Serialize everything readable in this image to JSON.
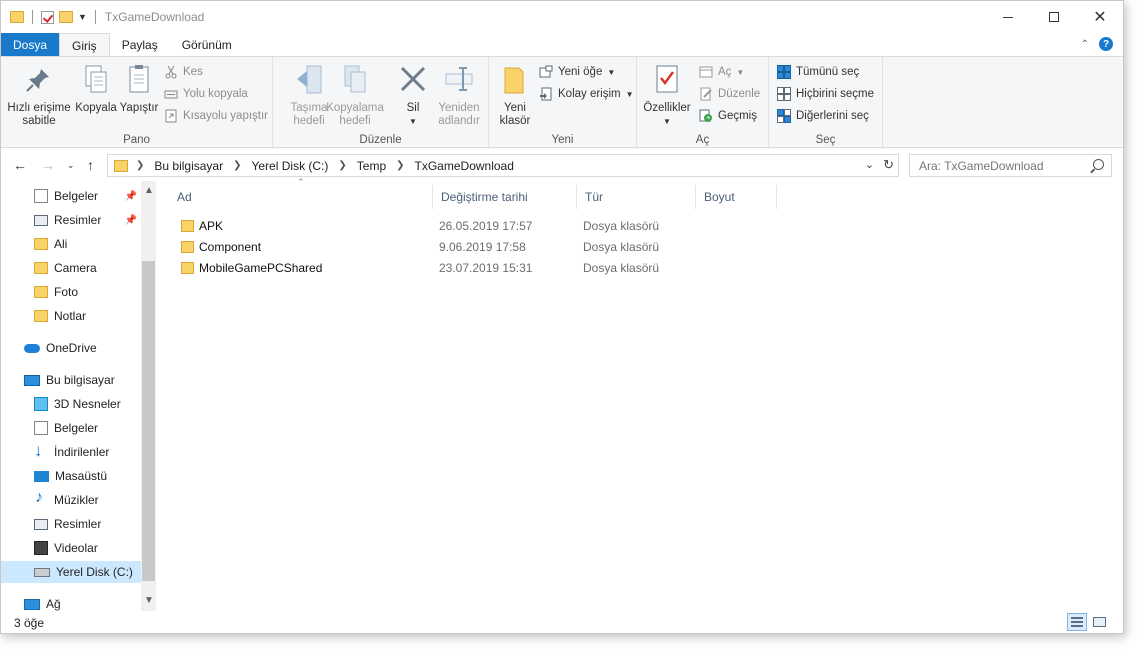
{
  "window": {
    "title": "TxGameDownload"
  },
  "tabs": {
    "file": "Dosya",
    "home": "Giriş",
    "share": "Paylaş",
    "view": "Görünüm",
    "help": "?"
  },
  "ribbon": {
    "pano": {
      "label": "Pano",
      "pin": [
        "Hızlı erişime",
        "sabitle"
      ],
      "copy": "Kopyala",
      "paste": "Yapıştır",
      "cut": "Kes",
      "copy_path": "Yolu kopyala",
      "paste_shortcut": "Kısayolu yapıştır"
    },
    "duzenle": {
      "label": "Düzenle",
      "move": [
        "Taşıma",
        "hedefi"
      ],
      "copyto": [
        "Kopyalama",
        "hedefi"
      ],
      "delete": "Sil",
      "rename": [
        "Yeniden",
        "adlandır"
      ]
    },
    "yeni": {
      "label": "Yeni",
      "new_folder": [
        "Yeni",
        "klasör"
      ],
      "new_item": "Yeni öğe",
      "easy_access": "Kolay erişim"
    },
    "ac": {
      "label": "Aç",
      "properties": "Özellikler",
      "open": "Aç",
      "edit": "Düzenle",
      "history": "Geçmiş"
    },
    "sec": {
      "label": "Seç",
      "select_all": "Tümünü seç",
      "select_none": "Hiçbirini seçme",
      "invert": "Diğerlerini seç"
    }
  },
  "address": {
    "crumbs": [
      "Bu bilgisayar",
      "Yerel Disk (C:)",
      "Temp",
      "TxGameDownload"
    ],
    "search_placeholder": "Ara: TxGameDownload"
  },
  "nav": {
    "items": [
      {
        "label": "Belgeler",
        "icon": "documents-icon",
        "pinned": true
      },
      {
        "label": "Resimler",
        "icon": "pictures-icon",
        "pinned": true
      },
      {
        "label": "Ali",
        "icon": "folder-icon"
      },
      {
        "label": "Camera",
        "icon": "folder-icon"
      },
      {
        "label": "Foto",
        "icon": "folder-icon"
      },
      {
        "label": "Notlar",
        "icon": "folder-icon"
      },
      {
        "label": "OneDrive",
        "icon": "onedrive-icon"
      },
      {
        "label": "Bu bilgisayar",
        "icon": "this-pc-icon"
      },
      {
        "label": "3D Nesneler",
        "icon": "3d-objects-icon"
      },
      {
        "label": "Belgeler",
        "icon": "documents-icon"
      },
      {
        "label": "İndirilenler",
        "icon": "downloads-icon"
      },
      {
        "label": "Masaüstü",
        "icon": "desktop-icon"
      },
      {
        "label": "Müzikler",
        "icon": "music-icon"
      },
      {
        "label": "Resimler",
        "icon": "pictures-icon"
      },
      {
        "label": "Videolar",
        "icon": "videos-icon"
      },
      {
        "label": "Yerel Disk (C:)",
        "icon": "drive-icon",
        "selected": true
      },
      {
        "label": "Ağ",
        "icon": "network-icon"
      }
    ]
  },
  "columns": {
    "name": "Ad",
    "date": "Değiştirme tarihi",
    "type": "Tür",
    "size": "Boyut"
  },
  "files": [
    {
      "name": "APK",
      "date": "26.05.2019 17:57",
      "type": "Dosya klasörü"
    },
    {
      "name": "Component",
      "date": "9.06.2019 17:58",
      "type": "Dosya klasörü"
    },
    {
      "name": "MobileGamePCShared",
      "date": "23.07.2019 15:31",
      "type": "Dosya klasörü"
    }
  ],
  "status": {
    "count": "3 öğe"
  }
}
